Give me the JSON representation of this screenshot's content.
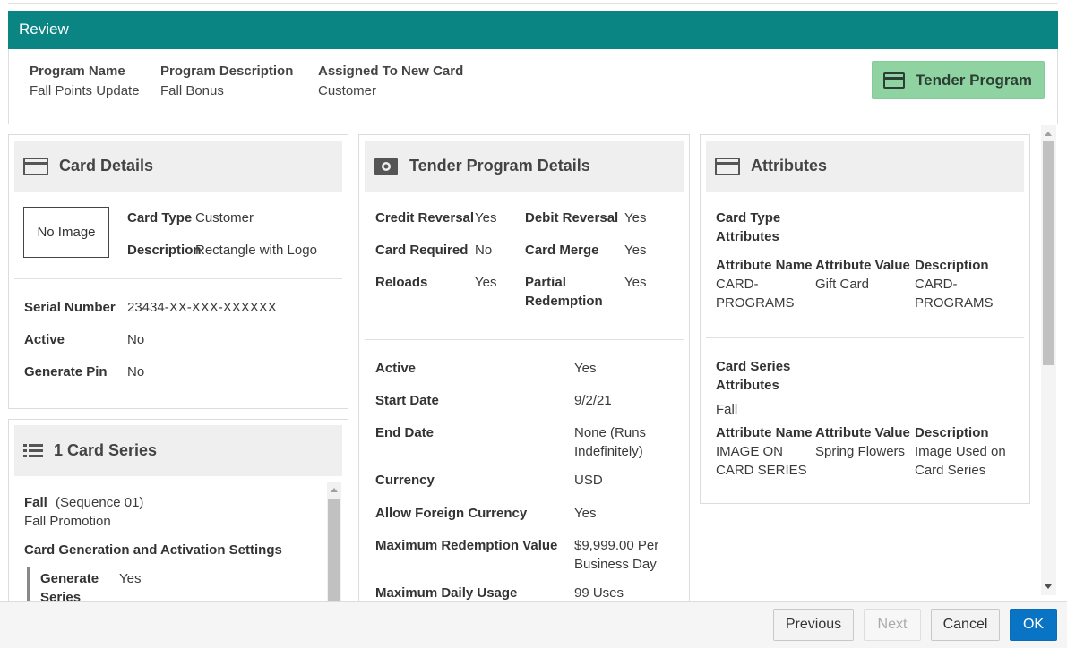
{
  "review": {
    "title": "Review",
    "program_name_label": "Program Name",
    "program_name": "Fall Points Update",
    "program_description_label": "Program Description",
    "program_description": "Fall Bonus",
    "assigned_label": "Assigned To New Card",
    "assigned_value": "Customer",
    "tender_button": "Tender Program"
  },
  "card_details": {
    "title": "Card Details",
    "no_image": "No Image",
    "card_type_label": "Card Type",
    "card_type": "Customer",
    "description_label": "Description",
    "description": "Rectangle with Logo",
    "serial_number_label": "Serial Number",
    "serial_number": "23434-XX-XXX-XXXXXX",
    "active_label": "Active",
    "active": "No",
    "generate_pin_label": "Generate Pin",
    "generate_pin": "No"
  },
  "card_series": {
    "title": "1 Card Series",
    "name": "Fall",
    "sequence": "(Sequence 01)",
    "promotion": "Fall Promotion",
    "settings_title": "Card Generation and Activation Settings",
    "generate_series_label_1": "Generate",
    "generate_series_label_2": "Series",
    "generate_series_value": "Yes"
  },
  "tender_details": {
    "title": "Tender Program Details",
    "credit_reversal_label": "Credit Reversal",
    "credit_reversal": "Yes",
    "debit_reversal_label": "Debit Reversal",
    "debit_reversal": "Yes",
    "card_required_label": "Card Required",
    "card_required": "No",
    "card_merge_label": "Card Merge",
    "card_merge": "Yes",
    "reloads_label": "Reloads",
    "reloads": "Yes",
    "partial_label_1": "Partial",
    "partial_label_2": "Redemption",
    "partial": "Yes",
    "active_label": "Active",
    "active": "Yes",
    "start_date_label": "Start Date",
    "start_date": "9/2/21",
    "end_date_label": "End Date",
    "end_date_1": "None (Runs",
    "end_date_2": "Indefinitely)",
    "currency_label": "Currency",
    "currency": "USD",
    "foreign_label": "Allow Foreign Currency",
    "foreign": "Yes",
    "max_redemption_label": "Maximum Redemption Value",
    "max_redemption_1": "$9,999.00 Per",
    "max_redemption_2": "Business Day",
    "max_daily_label": "Maximum Daily Usage",
    "max_daily": "99 Uses"
  },
  "attributes": {
    "title": "Attributes",
    "card_type_attrs_1": "Card Type",
    "card_type_attrs_2": "Attributes",
    "col_name": "Attribute Name",
    "col_value": "Attribute Value",
    "col_desc": "Description",
    "row1_name_1": "CARD-",
    "row1_name_2": "PROGRAMS",
    "row1_value": "Gift Card",
    "row1_desc_1": "CARD-",
    "row1_desc_2": "PROGRAMS",
    "series_attrs_1": "Card Series",
    "series_attrs_2": "Attributes",
    "series_name": "Fall",
    "row2_name_1": "IMAGE ON",
    "row2_name_2": "CARD SERIES",
    "row2_value": "Spring Flowers",
    "row2_desc_1": "Image Used on",
    "row2_desc_2": "Card Series"
  },
  "footer": {
    "previous": "Previous",
    "next": "Next",
    "cancel": "Cancel",
    "ok": "OK"
  },
  "colors": {
    "header_teal": "#0b8484",
    "tender_button_green": "#8fd3a2",
    "ok_blue": "#0a74c4"
  }
}
